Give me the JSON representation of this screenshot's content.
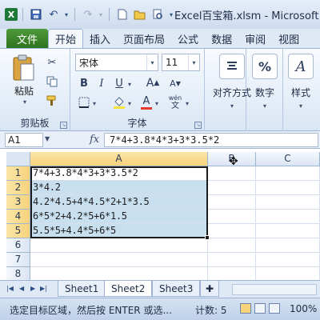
{
  "window": {
    "title": "Excel百宝箱.xlsm - Microsoft Ex"
  },
  "ribbon": {
    "file_tab": "文件",
    "tabs": [
      "开始",
      "插入",
      "页面布局",
      "公式",
      "数据",
      "审阅",
      "视图"
    ],
    "active_tab": "开始",
    "clipboard": {
      "paste_label": "粘贴",
      "group_label": "剪贴板"
    },
    "font": {
      "name": "宋体",
      "size": "11",
      "group_label": "字体",
      "bold": "B",
      "italic": "I",
      "underline": "U"
    },
    "alignment_label": "对齐方式",
    "number_label": "数字",
    "number_icon": "%",
    "styles_label": "样式"
  },
  "formula_bar": {
    "name_box": "A1",
    "fx": "fx",
    "formula": "7*4+3.8*4*3+3*3.5*2"
  },
  "grid": {
    "columns": [
      "A",
      "B",
      "C"
    ],
    "rows": [
      "1",
      "2",
      "3",
      "4",
      "5",
      "6",
      "7",
      "8"
    ],
    "cells_a": [
      "7*4+3.8*4*3+3*3.5*2",
      "3*4.2",
      "4.2*4.5+4*4.5*2+1*3.5",
      "6*5*2+4.2*5+6*1.5",
      "5.5*5+4.4*5+6*5",
      "",
      "",
      ""
    ]
  },
  "sheets": {
    "tabs": [
      "Sheet1",
      "Sheet2",
      "Sheet3"
    ],
    "active": "Sheet2"
  },
  "status": {
    "message": "选定目标区域，然后按 ENTER 或选...",
    "count": "计数: 5",
    "zoom": "100%"
  }
}
